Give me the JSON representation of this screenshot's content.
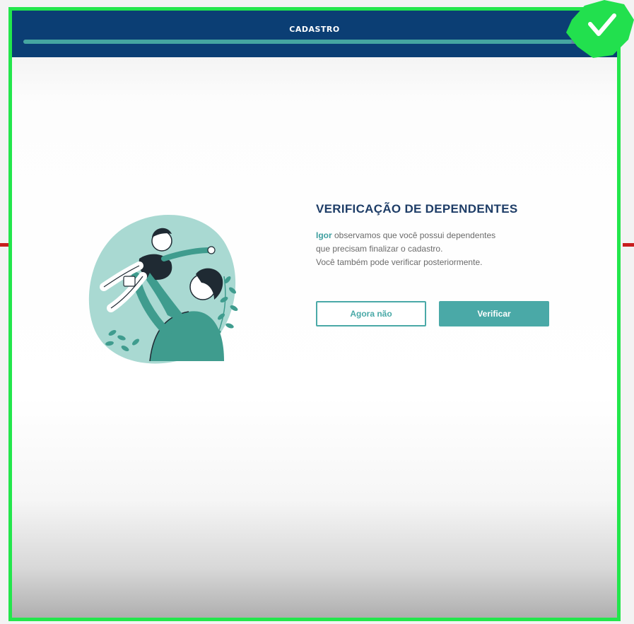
{
  "header": {
    "title": "CADASTRO",
    "progress": 0.97
  },
  "verification": {
    "title": "VERIFICAÇÃO DE DEPENDENTES",
    "user_name": "Igor",
    "message_line1": " observamos que você possui dependentes",
    "message_line2": "que precisam finalizar o cadastro.",
    "message_line3": "Você também pode verificar posteriormente."
  },
  "buttons": {
    "not_now": "Agora não",
    "verify": "Verificar"
  },
  "icons": {
    "badge": "check-icon",
    "illustration": "father-child-illustration"
  },
  "colors": {
    "header_bg": "#0b3e74",
    "accent": "#4aa9a7",
    "title": "#1e3d67",
    "frame": "#23e64c",
    "badge": "#22e04e"
  }
}
